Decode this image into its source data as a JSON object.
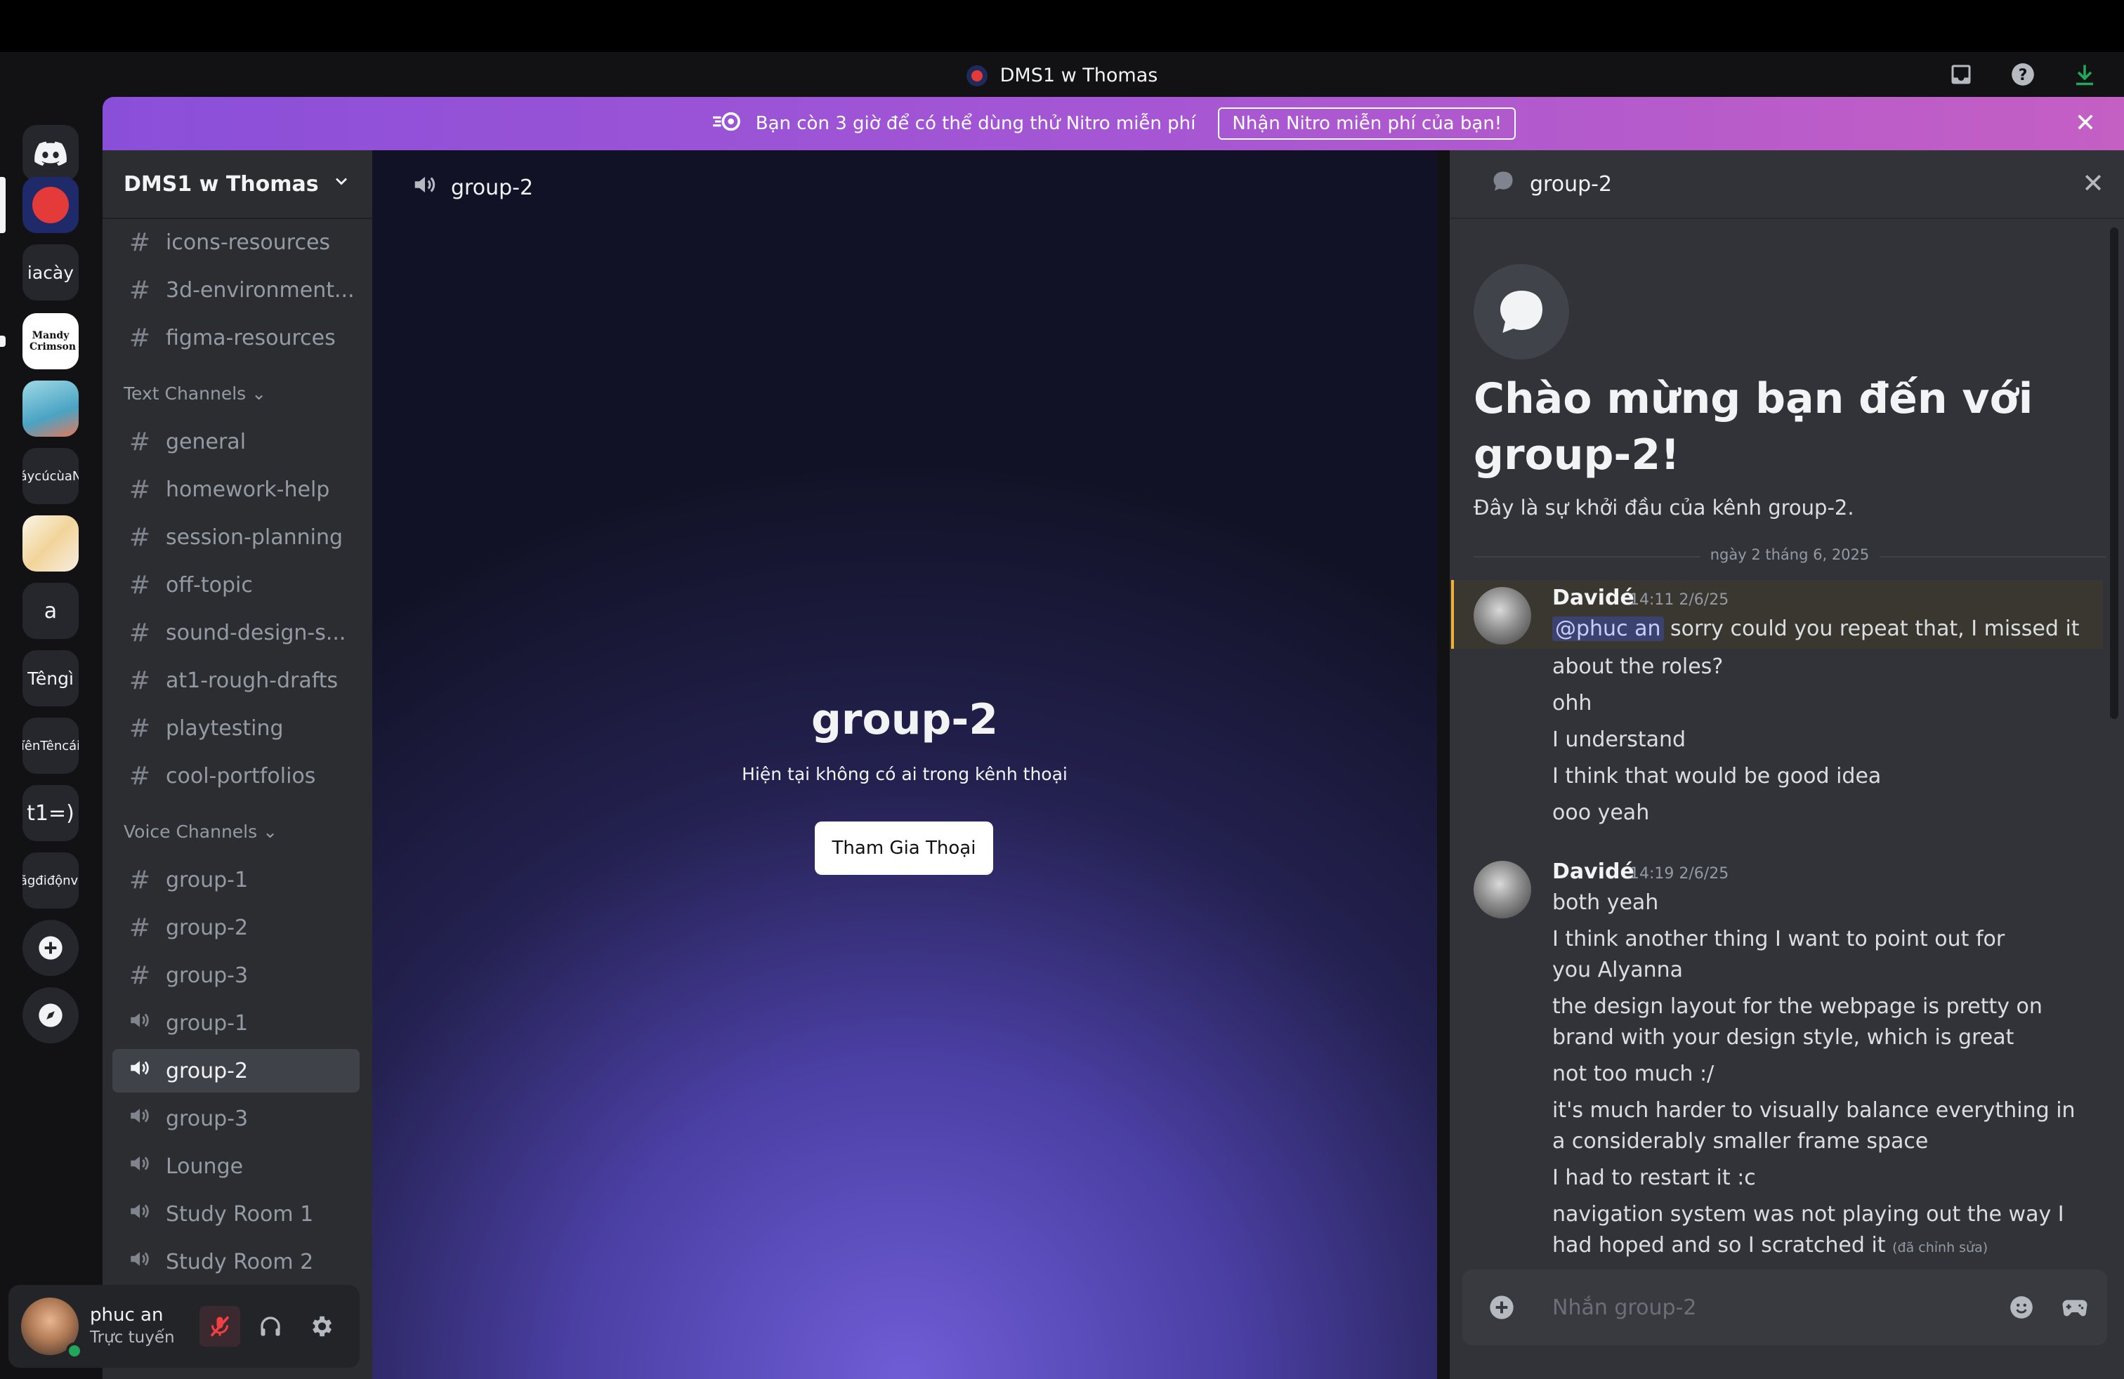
{
  "titlebar": {
    "title": "DMS1 w Thomas"
  },
  "banner": {
    "text": "Bạn còn 3 giờ để có thể dùng thử Nitro miễn phí",
    "cta": "Nhận Nitro miễn phí của bạn!"
  },
  "guilds": [
    {
      "label": "iacày"
    },
    {
      "label": "Mandy Crimson"
    },
    {
      "label": "áycúcùaN"
    },
    {
      "label": "a"
    },
    {
      "label": "Têngì"
    },
    {
      "label": "ĩênTêncái"
    },
    {
      "label": "t1=)"
    },
    {
      "label": "ãgđiđộnvị"
    }
  ],
  "server": {
    "name": "DMS1 w Thomas"
  },
  "channels": {
    "top": [
      "icons-resources",
      "3d-environment...",
      "figma-resources"
    ],
    "text_category": "Text Channels",
    "text": [
      "general",
      "homework-help",
      "session-planning",
      "off-topic",
      "sound-design-s...",
      "at1-rough-drafts",
      "playtesting",
      "cool-portfolios"
    ],
    "voice_category": "Voice Channels",
    "voice_text": [
      "group-1",
      "group-2",
      "group-3"
    ],
    "voice": [
      "group-1",
      "group-2",
      "group-3",
      "Lounge",
      "Study Room 1",
      "Study Room 2"
    ]
  },
  "user": {
    "name": "phuc an",
    "status": "Trực tuyến"
  },
  "stage": {
    "header": "group-2",
    "title": "group-2",
    "subtitle": "Hiện tại không có ai trong kênh thoại",
    "join": "Tham Gia Thoại"
  },
  "chat": {
    "header": "group-2",
    "welcome_title": "Chào mừng bạn đến với group-2!",
    "welcome_sub": "Đây là sự khởi đầu của kênh group-2.",
    "date_divider": "ngày 2 tháng 6, 2025",
    "groups": [
      {
        "author": "Davidé",
        "time": "14:11 2/6/25",
        "mention": "@phuc an",
        "lines": [
          "sorry could you repeat that, I missed it",
          "about the roles?",
          "ohh",
          "I understand",
          "I think that would be good idea",
          "ooo yeah"
        ]
      },
      {
        "author": "Davidé",
        "time": "14:19 2/6/25",
        "lines": [
          "both yeah",
          "I think another thing I want to point out for you Alyanna",
          "the design layout for the webpage is pretty on brand with your design style, which is great",
          "not too much :/",
          "it's much harder to visually balance everything in a considerably smaller frame space",
          "I had to restart it :c",
          "navigation system was not playing out the way I had hoped and so I scratched it"
        ],
        "edited": "(đã chỉnh sửa)"
      }
    ],
    "composer_placeholder": "Nhắn group-2"
  },
  "colors": {
    "accent": "#5865f2",
    "online": "#23a55a",
    "banner_start": "#8a4fd9",
    "banner_end": "#c45fc4",
    "mute_red": "#f23f43"
  },
  "icons": [
    "discord-icon",
    "inbox-icon",
    "help-icon",
    "download-icon",
    "nitro-icon",
    "close-icon",
    "hash-icon",
    "speaker-icon",
    "chevron-down-icon",
    "mic-muted-icon",
    "headphones-icon",
    "gear-icon",
    "chat-bubble-icon",
    "add-server-icon",
    "discover-icon",
    "plus-circle-icon",
    "emoji-icon",
    "gamepad-icon"
  ]
}
